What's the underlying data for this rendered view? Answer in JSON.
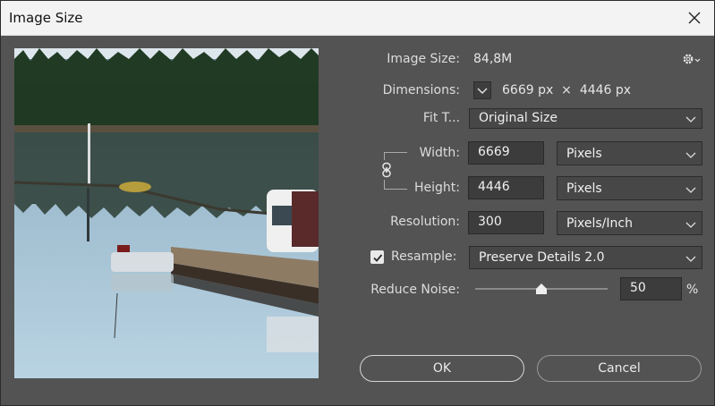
{
  "window": {
    "title": "Image Size"
  },
  "image_size": {
    "label": "Image Size:",
    "value": "84,8M"
  },
  "dimensions": {
    "label": "Dimensions:",
    "width": "6669",
    "width_unit": "px",
    "times": "×",
    "height": "4446",
    "height_unit": "px"
  },
  "fit_to": {
    "label": "Fit T...",
    "selected": "Original Size"
  },
  "width": {
    "label": "Width:",
    "value": "6669",
    "unit": "Pixels"
  },
  "height": {
    "label": "Height:",
    "value": "4446",
    "unit": "Pixels"
  },
  "resolution": {
    "label": "Resolution:",
    "value": "300",
    "unit": "Pixels/Inch"
  },
  "resample": {
    "label": "Resample:",
    "checked": true,
    "method": "Preserve Details 2.0"
  },
  "reduce_noise": {
    "label": "Reduce Noise:",
    "value": "50",
    "unit": "%",
    "level_percent": 50
  },
  "buttons": {
    "ok": "OK",
    "cancel": "Cancel"
  },
  "icons": {
    "close": "close-icon",
    "gear": "gear-icon",
    "chevron": "chevron-down-icon",
    "link": "link-icon",
    "check": "check-icon"
  },
  "colors": {
    "dialog_bg": "#535353",
    "titlebar_bg": "#f3f3f3",
    "field_bg": "#3c3c3c"
  }
}
